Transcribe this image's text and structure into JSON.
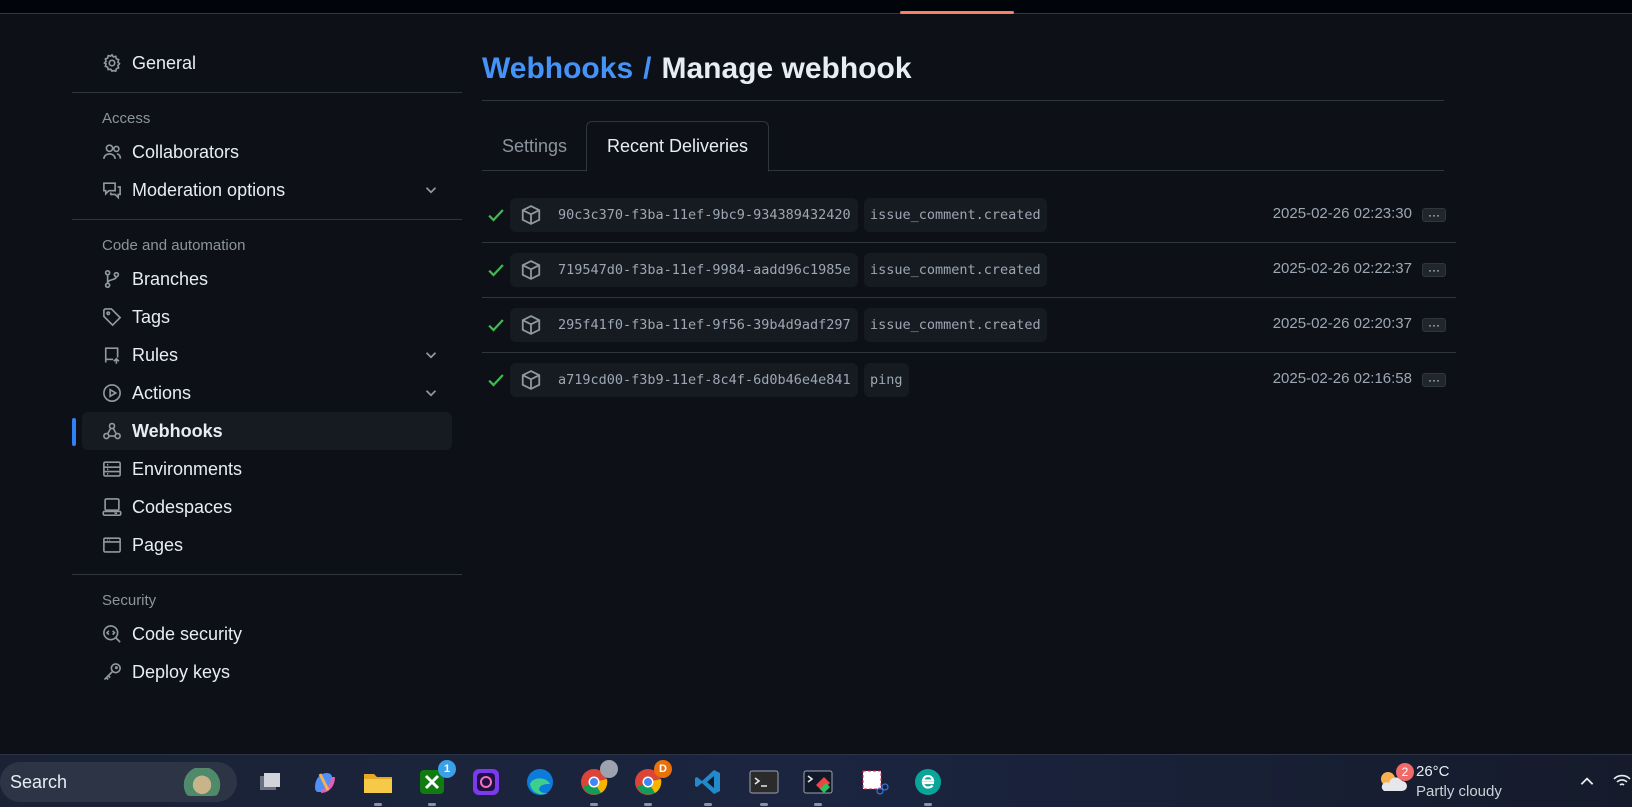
{
  "sidebar": {
    "general": "General",
    "sections": {
      "access": "Access",
      "code_automation": "Code and automation",
      "security": "Security"
    },
    "items": {
      "collaborators": "Collaborators",
      "moderation": "Moderation options",
      "branches": "Branches",
      "tags": "Tags",
      "rules": "Rules",
      "actions": "Actions",
      "webhooks": "Webhooks",
      "environments": "Environments",
      "codespaces": "Codespaces",
      "pages": "Pages",
      "code_security": "Code security",
      "deploy_keys": "Deploy keys"
    }
  },
  "header": {
    "breadcrumb_link": "Webhooks",
    "separator": "/",
    "current": "Manage webhook"
  },
  "tabs": {
    "settings": "Settings",
    "recent_deliveries": "Recent Deliveries"
  },
  "deliveries": [
    {
      "guid": "90c3c370-f3ba-11ef-9bc9-934389432420",
      "event": "issue_comment.created",
      "timestamp": "2025-02-26 02:23:30",
      "more": "···"
    },
    {
      "guid": "719547d0-f3ba-11ef-9984-aadd96c1985e",
      "event": "issue_comment.created",
      "timestamp": "2025-02-26 02:22:37",
      "more": "···"
    },
    {
      "guid": "295f41f0-f3ba-11ef-9f56-39b4d9adf297",
      "event": "issue_comment.created",
      "timestamp": "2025-02-26 02:20:37",
      "more": "···"
    },
    {
      "guid": "a719cd00-f3b9-11ef-8c4f-6d0b46e4e841",
      "event": "ping",
      "timestamp": "2025-02-26 02:16:58",
      "more": "···"
    }
  ],
  "colors": {
    "accent": "#2f81f7",
    "link": "#4493f8",
    "success": "#3fb950",
    "bg": "#0d1117"
  },
  "taskbar": {
    "search_label": "Search",
    "xbox_badge": "1",
    "chrome_badge": "D",
    "weather_badge": "2",
    "weather_temp": "26°C",
    "weather_cond": "Partly cloudy"
  }
}
